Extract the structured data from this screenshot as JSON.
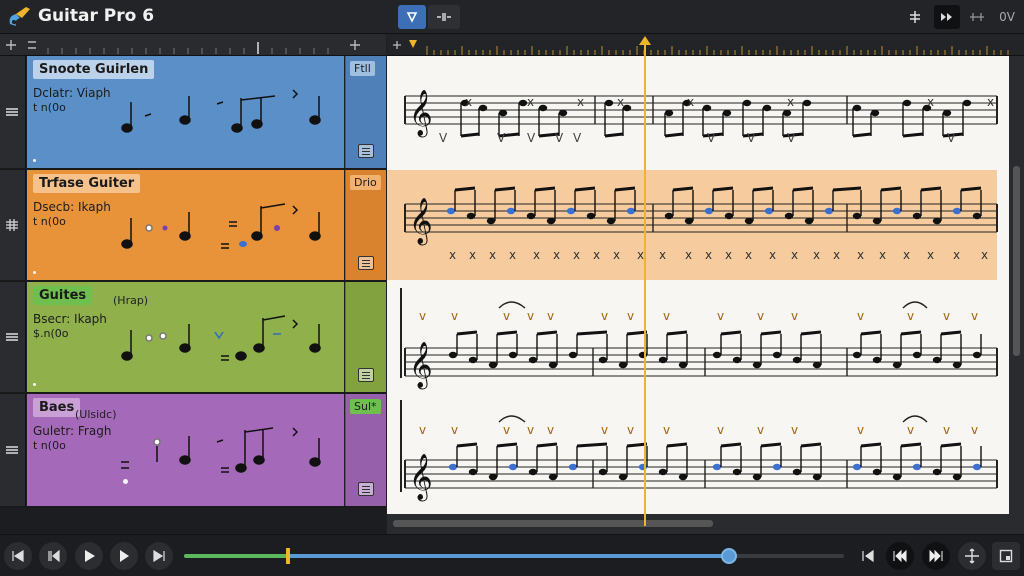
{
  "app": {
    "title": "Guitar Pro 6"
  },
  "toolbar": {
    "right_label": "0V"
  },
  "tracks": [
    {
      "name": "Snoote Guirlen",
      "sub": "",
      "info1": "Dclatr: Viaph",
      "info2": "t n(0o",
      "tag": "Ftll",
      "color": "#5b8fc8",
      "sidecolor": "#4f81b8",
      "namebg": "#bcd2ea",
      "tagbg": "#9fbfe0"
    },
    {
      "name": "Trfase Guiter",
      "sub": "",
      "info1": "Dsecb: Ikaph",
      "info2": "t n(0o",
      "tag": "Drio",
      "color": "#e8923a",
      "sidecolor": "#d9832f",
      "namebg": "#f6c28b",
      "tagbg": "#f3b16f"
    },
    {
      "name": "Guites",
      "sub": "(Hrap)",
      "info1": "Bsecr: Ikaph",
      "info2": "$.n(0o",
      "tag": "",
      "color": "#8fb04a",
      "sidecolor": "#82a23f",
      "namebg": "#6fbf4e",
      "tagbg": "#9cc05e"
    },
    {
      "name": "Baes",
      "sub": "(Ulsidc)",
      "info1": "Guletr: Fragh",
      "info2": "t n(0o",
      "tag": "Sul*",
      "color": "#a469b8",
      "sidecolor": "#9660aa",
      "namebg": "#c9a1d6",
      "tagbg": "#6fbf4e"
    }
  ]
}
